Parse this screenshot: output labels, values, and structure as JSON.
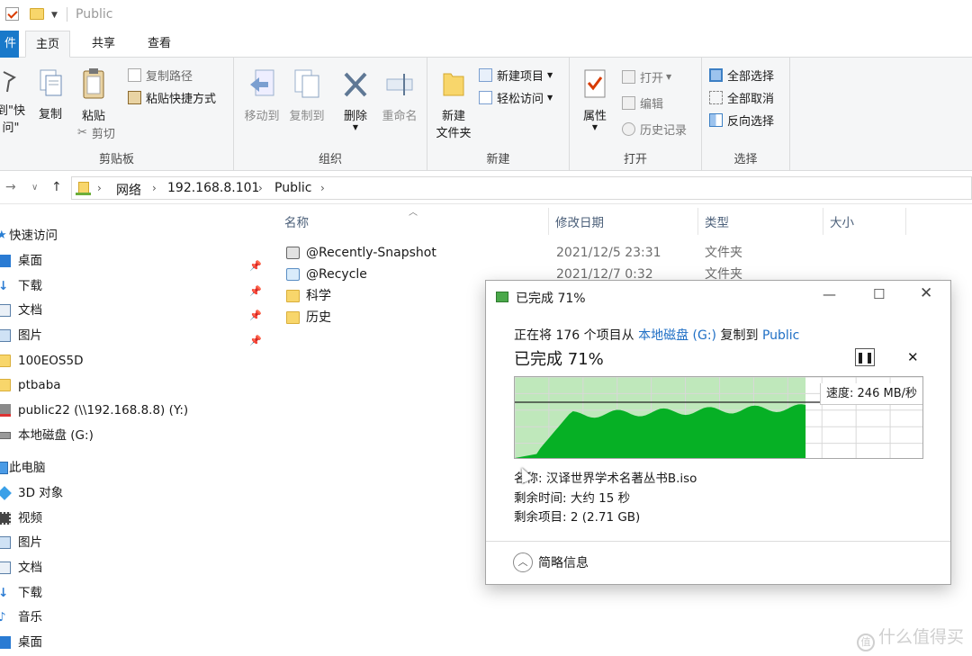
{
  "window": {
    "title": "Public"
  },
  "ribbon_tabs": {
    "file": "件",
    "home": "主页",
    "share": "共享",
    "view": "查看"
  },
  "ribbon": {
    "clipboard": {
      "pin_label_line1": "到\"快",
      "pin_label_line2": "问\"",
      "copy": "复制",
      "paste": "粘贴",
      "copy_path": "复制路径",
      "paste_shortcut": "粘贴快捷方式",
      "cut": "剪切",
      "group": "剪贴板"
    },
    "organize": {
      "move_to": "移动到",
      "copy_to": "复制到",
      "delete": "删除",
      "rename": "重命名",
      "group": "组织"
    },
    "new": {
      "new_folder_line1": "新建",
      "new_folder_line2": "文件夹",
      "new_item": "新建项目",
      "easy_access": "轻松访问",
      "group": "新建"
    },
    "open": {
      "properties": "属性",
      "open": "打开",
      "edit": "编辑",
      "history": "历史记录",
      "group": "打开"
    },
    "select": {
      "select_all": "全部选择",
      "select_none": "全部取消",
      "invert": "反向选择",
      "group": "选择"
    }
  },
  "address": {
    "crumbs": [
      "网络",
      "192.168.8.101",
      "Public"
    ]
  },
  "nav": [
    {
      "label": "快速访问",
      "icon": "star-icon",
      "pinned": false
    },
    {
      "label": "桌面",
      "icon": "desktop-icon",
      "pinned": true
    },
    {
      "label": "下载",
      "icon": "download-icon",
      "pinned": true
    },
    {
      "label": "文档",
      "icon": "document-icon",
      "pinned": true
    },
    {
      "label": "图片",
      "icon": "picture-icon",
      "pinned": true
    },
    {
      "label": "100EOS5D",
      "icon": "folder-icon",
      "pinned": false
    },
    {
      "label": "ptbaba",
      "icon": "network-folder-icon",
      "pinned": false
    },
    {
      "label": "public22 (\\\\192.168.8.8) (Y:)",
      "icon": "disconnected-drive-icon",
      "pinned": false
    },
    {
      "label": "本地磁盘 (G:)",
      "icon": "drive-icon",
      "pinned": false
    },
    {
      "label": "此电脑",
      "icon": "computer-icon",
      "pinned": false
    },
    {
      "label": "3D 对象",
      "icon": "3d-objects-icon",
      "pinned": false
    },
    {
      "label": "视频",
      "icon": "video-icon",
      "pinned": false
    },
    {
      "label": "图片",
      "icon": "picture-icon",
      "pinned": false
    },
    {
      "label": "文档",
      "icon": "document-icon",
      "pinned": false
    },
    {
      "label": "下载",
      "icon": "download-icon",
      "pinned": false
    },
    {
      "label": "音乐",
      "icon": "music-icon",
      "pinned": false
    },
    {
      "label": "桌面",
      "icon": "desktop-icon",
      "pinned": false
    }
  ],
  "columns": {
    "name": "名称",
    "date": "修改日期",
    "type": "类型",
    "size": "大小"
  },
  "files": [
    {
      "name": "@Recently-Snapshot",
      "date": "2021/12/5 23:31",
      "type": "文件夹",
      "icon": "snapshot-folder-icon"
    },
    {
      "name": "@Recycle",
      "date": "2021/12/7 0:32",
      "type": "文件夹",
      "icon": "recycle-folder-icon"
    },
    {
      "name": "科学",
      "date": "",
      "type": "",
      "icon": "folder-icon"
    },
    {
      "name": "历史",
      "date": "",
      "type": "",
      "icon": "folder-icon"
    }
  ],
  "dialog": {
    "title": "已完成 71%",
    "line_prefix": "正在将 176 个项目从 ",
    "source": "本地磁盘 (G:)",
    "line_mid": " 复制到 ",
    "dest": "Public",
    "percent_text": "已完成 71%",
    "progress": 0.71,
    "speed": "速度: 246 MB/秒",
    "name_line": "名称: 汉译世界学术名著丛书B.iso",
    "time_left": "剩余时间: 大约 15 秒",
    "items_left": "剩余项目: 2 (2.71 GB)",
    "less_info": "简略信息"
  },
  "watermark": "什么值得买",
  "colors": {
    "accent": "#1979ca",
    "progress_green": "#06b025",
    "progress_bg": "#bfe8bb",
    "link": "#1f6fc5"
  }
}
